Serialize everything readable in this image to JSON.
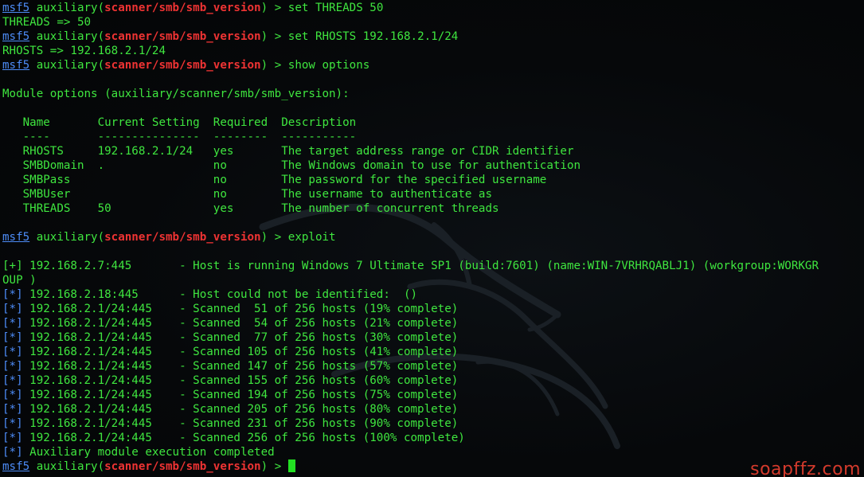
{
  "prompt": {
    "framework": "msf5",
    "context_prefix": " auxiliary(",
    "module": "scanner/smb/smb_version",
    "context_suffix": ") > "
  },
  "history": [
    {
      "type": "prompt",
      "command": "set THREADS 50"
    },
    {
      "type": "output",
      "text": "THREADS => 50"
    },
    {
      "type": "prompt",
      "command": "set RHOSTS 192.168.2.1/24"
    },
    {
      "type": "output",
      "text": "RHOSTS => 192.168.2.1/24"
    },
    {
      "type": "prompt",
      "command": "show options"
    },
    {
      "type": "blank"
    },
    {
      "type": "output",
      "text": "Module options (auxiliary/scanner/smb/smb_version):"
    },
    {
      "type": "blank"
    },
    {
      "type": "output",
      "text": "   Name       Current Setting  Required  Description"
    },
    {
      "type": "output",
      "text": "   ----       ---------------  --------  -----------"
    },
    {
      "type": "output",
      "text": "   RHOSTS     192.168.2.1/24   yes       The target address range or CIDR identifier"
    },
    {
      "type": "output",
      "text": "   SMBDomain  .                no        The Windows domain to use for authentication"
    },
    {
      "type": "output",
      "text": "   SMBPass                     no        The password for the specified username"
    },
    {
      "type": "output",
      "text": "   SMBUser                     no        The username to authenticate as"
    },
    {
      "type": "output",
      "text": "   THREADS    50               yes       The number of concurrent threads"
    },
    {
      "type": "blank"
    },
    {
      "type": "prompt",
      "command": "exploit"
    },
    {
      "type": "blank"
    },
    {
      "type": "status",
      "marker": "[+]",
      "text": " 192.168.2.7:445       - Host is running Windows 7 Ultimate SP1 (build:7601) (name:WIN-7VRHRQABLJ1) (workgroup:WORKGR"
    },
    {
      "type": "output",
      "text": "OUP )"
    },
    {
      "type": "status",
      "marker": "[*]",
      "text": " 192.168.2.18:445      - Host could not be identified:  ()"
    },
    {
      "type": "status",
      "marker": "[*]",
      "text": " 192.168.2.1/24:445    - Scanned  51 of 256 hosts (19% complete)"
    },
    {
      "type": "status",
      "marker": "[*]",
      "text": " 192.168.2.1/24:445    - Scanned  54 of 256 hosts (21% complete)"
    },
    {
      "type": "status",
      "marker": "[*]",
      "text": " 192.168.2.1/24:445    - Scanned  77 of 256 hosts (30% complete)"
    },
    {
      "type": "status",
      "marker": "[*]",
      "text": " 192.168.2.1/24:445    - Scanned 105 of 256 hosts (41% complete)"
    },
    {
      "type": "status",
      "marker": "[*]",
      "text": " 192.168.2.1/24:445    - Scanned 147 of 256 hosts (57% complete)"
    },
    {
      "type": "status",
      "marker": "[*]",
      "text": " 192.168.2.1/24:445    - Scanned 155 of 256 hosts (60% complete)"
    },
    {
      "type": "status",
      "marker": "[*]",
      "text": " 192.168.2.1/24:445    - Scanned 194 of 256 hosts (75% complete)"
    },
    {
      "type": "status",
      "marker": "[*]",
      "text": " 192.168.2.1/24:445    - Scanned 205 of 256 hosts (80% complete)"
    },
    {
      "type": "status",
      "marker": "[*]",
      "text": " 192.168.2.1/24:445    - Scanned 231 of 256 hosts (90% complete)"
    },
    {
      "type": "status",
      "marker": "[*]",
      "text": " 192.168.2.1/24:445    - Scanned 256 of 256 hosts (100% complete)"
    },
    {
      "type": "status",
      "marker": "[*]",
      "text": " Auxiliary module execution completed"
    },
    {
      "type": "current_prompt"
    }
  ],
  "watermark_text": "soapffz.com",
  "colors": {
    "background": "#06080a",
    "text": "#3fe63f",
    "prompt_framework": "#4d8cf7",
    "module": "#ee3333",
    "status_marker_info": "#4d8cf7",
    "status_marker_good": "#3fe63f",
    "cursor": "#22e022",
    "brand": "#d43a2c"
  },
  "background_icon": "kali-dragon-icon"
}
